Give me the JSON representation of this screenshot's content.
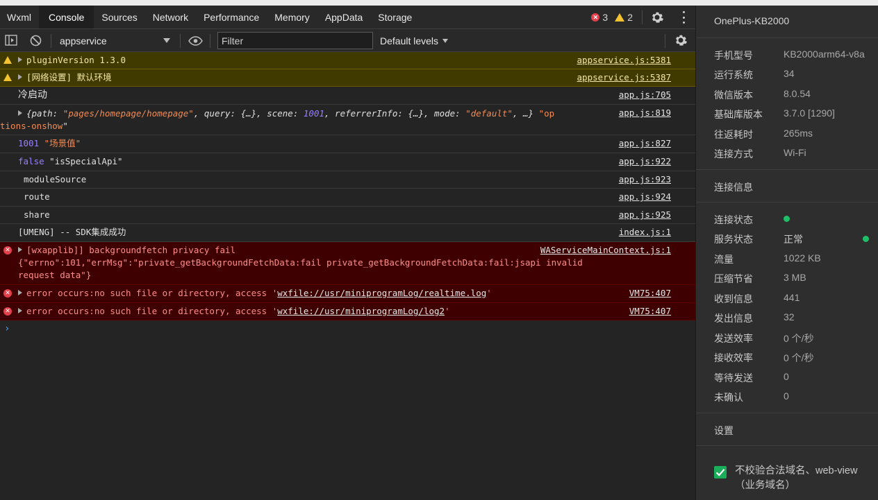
{
  "tabs": [
    "Wxml",
    "Console",
    "Sources",
    "Network",
    "Performance",
    "Memory",
    "AppData",
    "Storage"
  ],
  "counts": {
    "errors": "3",
    "warnings": "2"
  },
  "toolbar": {
    "context": "appservice",
    "filter_placeholder": "Filter",
    "levels": "Default levels"
  },
  "console": {
    "r1": {
      "text": "pluginVersion 1.3.0",
      "src": "appservice.js:5381"
    },
    "r2": {
      "text": "[网络设置] 默认环境",
      "src": "appservice.js:5387"
    },
    "r3": {
      "text": "冷启动",
      "src": "app.js:705"
    },
    "r4": {
      "src": "app.js:819",
      "p1": "{path: ",
      "p2": "\"pages/homepage/homepage\"",
      "p3": ", query: {…}, scene: ",
      "p4": "1001",
      "p5": ", referrerInfo: {…}, mode: ",
      "p6": "\"default\"",
      "p7": ", …} ",
      "p8": "\"op",
      "p9": "tions-onshow",
      "p10": "\""
    },
    "r5": {
      "num": "1001",
      "str": "\"场景值\"",
      "src": "app.js:827"
    },
    "r6": {
      "kw": "false",
      "str": "\"isSpecialApi\"",
      "src": "app.js:922"
    },
    "r7": {
      "text": "moduleSource",
      "src": "app.js:923"
    },
    "r8": {
      "text": "route",
      "src": "app.js:924"
    },
    "r9": {
      "text": "share",
      "src": "app.js:925"
    },
    "r10": {
      "text": "[UMENG] -- SDK集成成功",
      "src": "index.js:1"
    },
    "r11": {
      "line1": "[wxapplib]] backgroundfetch privacy fail",
      "line2": "{\"errno\":101,\"errMsg\":\"private_getBackgroundFetchData:fail private_getBackgroundFetchData:fail:jsapi invalid",
      "line3": "request data\"}",
      "src": "WAServiceMainContext.js:1"
    },
    "r12": {
      "prefix": "error occurs:no such file or directory, access '",
      "link": "wxfile://usr/miniprogramLog/realtime.log",
      "suffix": "'",
      "src": "VM75:407"
    },
    "r13": {
      "prefix": "error occurs:no such file or directory, access '",
      "link": "wxfile://usr/miniprogramLog/log2",
      "suffix": "'",
      "src": "VM75:407"
    },
    "prompt": "›"
  },
  "side": {
    "device": "OnePlus-KB2000",
    "info": [
      {
        "k": "手机型号",
        "v": "KB2000arm64-v8a"
      },
      {
        "k": "运行系统",
        "v": "34"
      },
      {
        "k": "微信版本",
        "v": "8.0.54"
      },
      {
        "k": "基础库版本",
        "v": "3.7.0 [1290]"
      },
      {
        "k": "往返耗时",
        "v": "265ms"
      },
      {
        "k": "连接方式",
        "v": "Wi-Fi"
      }
    ],
    "conn_title": "连接信息",
    "conn": [
      {
        "k": "连接状态",
        "v": ""
      },
      {
        "k": "服务状态",
        "v": "正常"
      },
      {
        "k": "流量",
        "v": "1022 KB"
      },
      {
        "k": "压缩节省",
        "v": "3 MB"
      },
      {
        "k": "收到信息",
        "v": "441"
      },
      {
        "k": "发出信息",
        "v": "32"
      },
      {
        "k": "发送效率",
        "v": "0 个/秒"
      },
      {
        "k": "接收效率",
        "v": "0 个/秒"
      },
      {
        "k": "等待发送",
        "v": "0"
      },
      {
        "k": "未确认",
        "v": "0"
      }
    ],
    "settings_title": "设置",
    "checkbox_label": "不校验合法域名、web-view（业务域名）"
  },
  "colors": {
    "accent_green": "#1fbf6a",
    "error": "#e2404a",
    "warning": "#f4c430"
  }
}
